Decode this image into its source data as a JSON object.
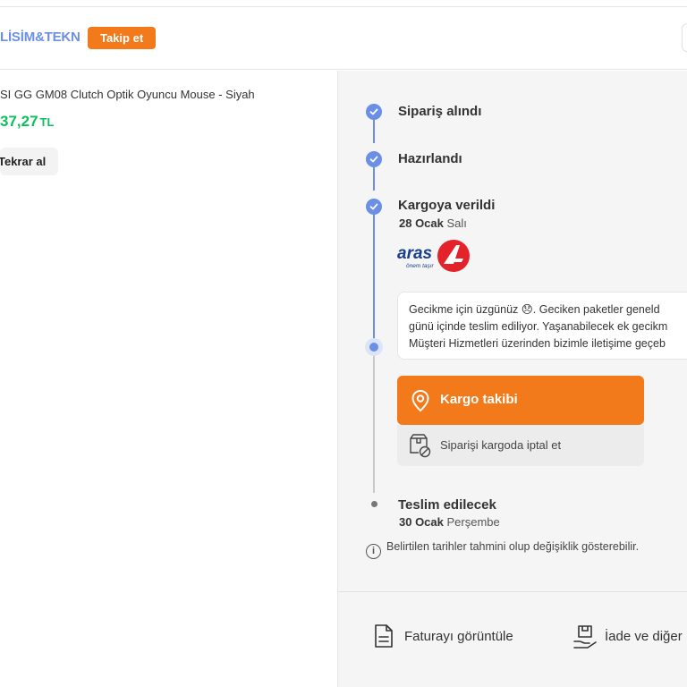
{
  "header": {
    "store_name": "LİSİM&TEKN",
    "follow_label": "Takip et"
  },
  "product": {
    "name": "SI GG GM08 Clutch Optik Oyuncu Mouse - Siyah",
    "price": "37,27",
    "currency": "TL",
    "rebuy_label": "Tekrar al"
  },
  "timeline": {
    "steps": [
      {
        "title": "Sipariş alındı"
      },
      {
        "title": "Hazırlandı"
      },
      {
        "title": "Kargoya verildi",
        "date_bold": "28 Ocak",
        "date_rest": "Salı"
      }
    ],
    "carrier": {
      "logo_text": "aras",
      "tagline": "önem taşır"
    },
    "notice": {
      "line1": "Gecikme için üzgünüz 😞. Geciken paketler geneld",
      "line2": "günü içinde teslim ediliyor. Yaşanabilecek ek gecikm",
      "line3": "Müşteri Hizmetleri üzerinden bizimle iletişime geçeb"
    },
    "cargo_track_label": "Kargo takibi",
    "cancel_label": "Siparişi kargoda iptal et",
    "delivery": {
      "title": "Teslim edilecek",
      "date_bold": "30 Ocak",
      "date_rest": "Perşembe"
    },
    "disclaimer": "Belirtilen tarihler tahmini olup değişiklik gösterebilir."
  },
  "actions": {
    "invoice_label": "Faturayı görüntüle",
    "return_label": "İade ve diğer"
  },
  "colors": {
    "accent_orange": "#f27a1a",
    "timeline_blue": "#6b8fe6",
    "price_green": "#0bc15c",
    "aras_red": "#e4222a",
    "aras_blue": "#1b3f8f"
  },
  "icons": {
    "step_done": "check-circle-icon",
    "cargo": "location-pin-icon",
    "cancel": "box-cancel-icon",
    "info": "info-icon",
    "invoice": "document-icon",
    "return": "return-hand-icon"
  }
}
